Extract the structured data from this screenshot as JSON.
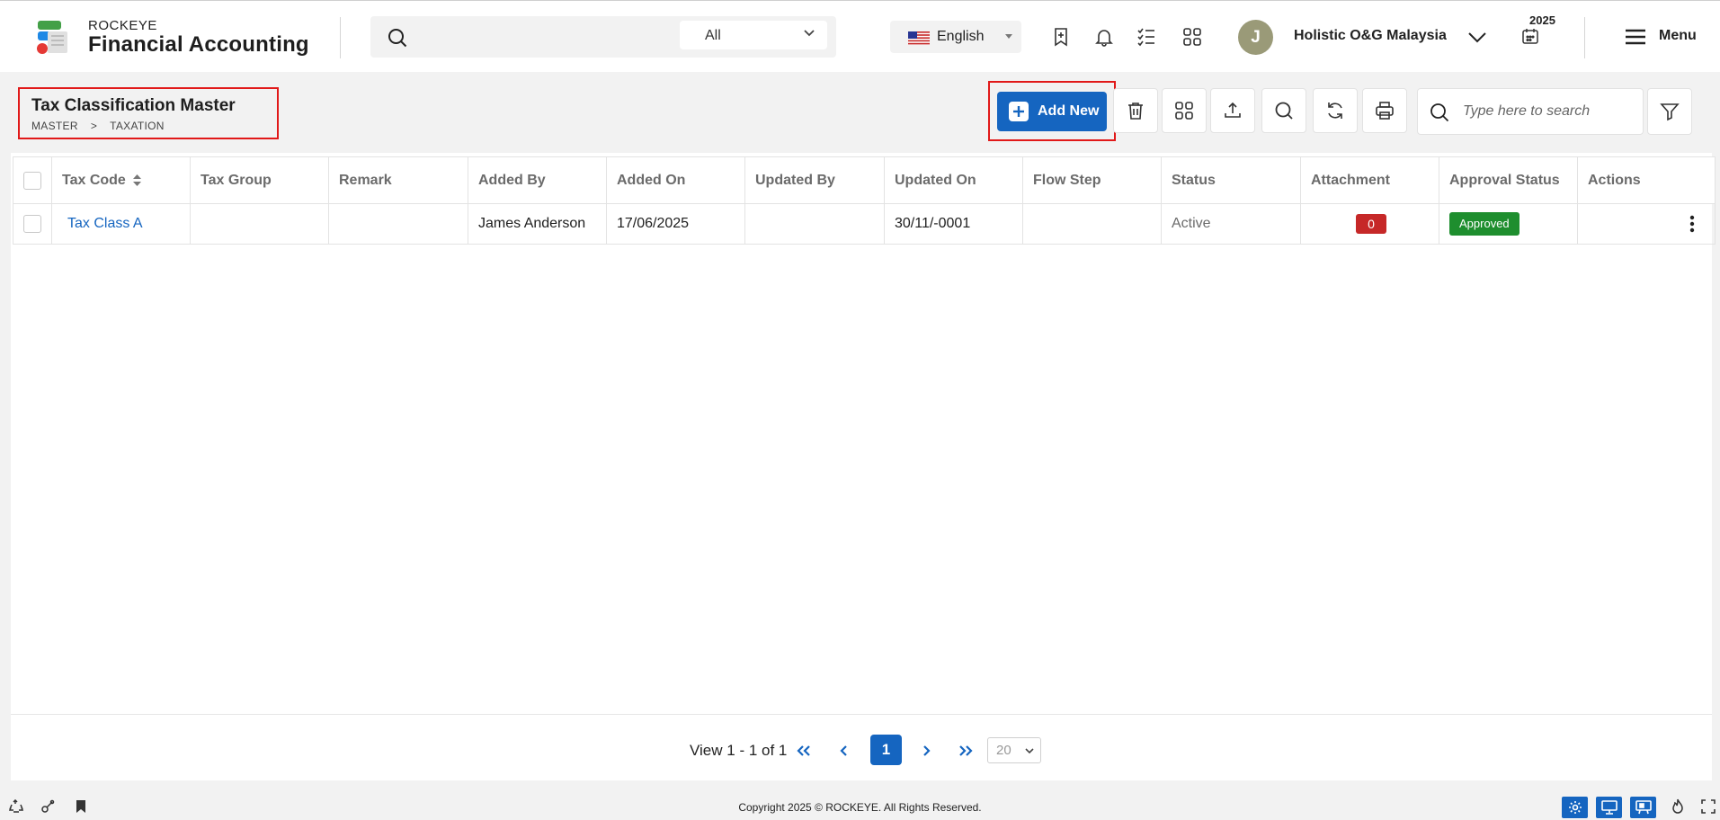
{
  "app": {
    "brand_small": "ROCKEYE",
    "brand_big": "Financial Accounting"
  },
  "header": {
    "search_placeholder": "",
    "search_scope": "All",
    "language": "English",
    "user_initial": "J",
    "company": "Holistic O&G Malaysia",
    "year": "2025",
    "menu_label": "Menu"
  },
  "page": {
    "title": "Tax Classification Master",
    "breadcrumb": [
      "MASTER",
      ">",
      "TAXATION"
    ]
  },
  "toolbar": {
    "add_label": "Add New",
    "search_placeholder": "Type here to search"
  },
  "table": {
    "columns": [
      "Tax Code",
      "Tax Group",
      "Remark",
      "Added By",
      "Added On",
      "Updated By",
      "Updated On",
      "Flow Step",
      "Status",
      "Attachment",
      "Approval Status",
      "Actions"
    ],
    "rows": [
      {
        "tax_code": "Tax Class A",
        "tax_group": "",
        "remark": "",
        "added_by": "James Anderson",
        "added_on": "17/06/2025",
        "updated_by": "",
        "updated_on": "30/11/-0001",
        "flow_step": "",
        "status": "Active",
        "attachment": "0",
        "approval_status": "Approved"
      }
    ]
  },
  "pagination": {
    "summary": "View 1 - 1 of 1",
    "current_page": "1",
    "page_size": "20"
  },
  "footer": {
    "copyright": "Copyright 2025 © ROCKEYE. All Rights Reserved."
  },
  "colors": {
    "primary": "#1565c0",
    "highlight": "#e11919",
    "danger": "#c62828",
    "success": "#1e8e2e"
  }
}
